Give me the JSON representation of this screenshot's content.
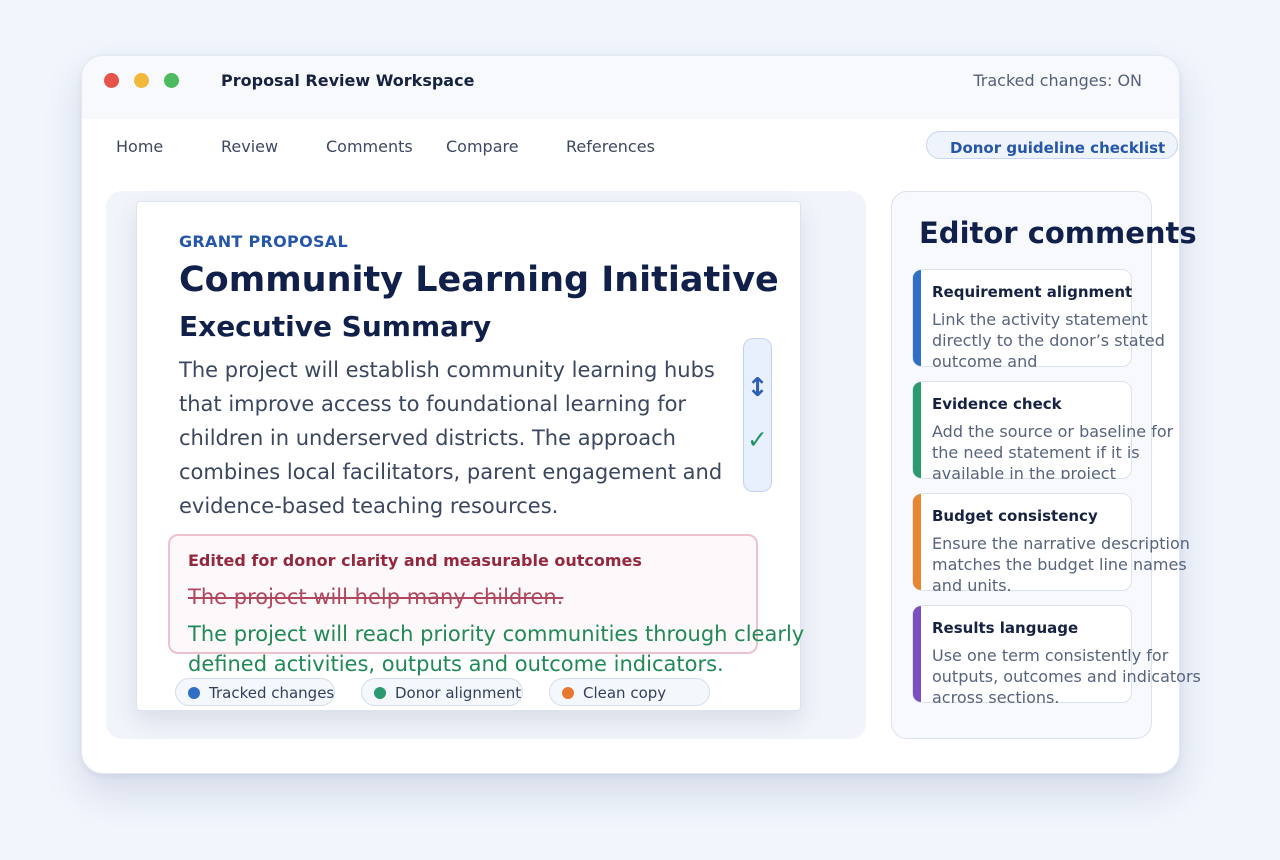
{
  "window": {
    "title": "Proposal Review Workspace",
    "tracked_status": "Tracked changes: ON"
  },
  "menu": {
    "items": [
      "Home",
      "Review",
      "Comments",
      "Compare",
      "References"
    ],
    "checklist_button": "Donor guideline checklist"
  },
  "document": {
    "kicker": "GRANT PROPOSAL",
    "title": "Community Learning Initiative",
    "subtitle": "Executive Summary",
    "body": "The project will establish community learning hubs that improve access to foundational learning for children in underserved districts. The approach combines local facilitators, parent engagement and evidence-based teaching resources.",
    "change": {
      "title": "Edited for donor clarity and measurable outcomes",
      "deleted": "The project will help many children.",
      "inserted": "The project will reach priority communities through clearly defined activities, outputs and outcome indicators."
    },
    "chips": [
      {
        "label": "Tracked changes",
        "color": "#2f6fc6"
      },
      {
        "label": "Donor alignment",
        "color": "#2a9a6f"
      },
      {
        "label": "Clean copy",
        "color": "#e8782f"
      }
    ],
    "tools": {
      "resize_icon": "vertical-resize-icon",
      "accept_icon": "checkmark-icon"
    }
  },
  "comments": {
    "title": "Editor comments",
    "items": [
      {
        "title": "Requirement alignment",
        "text": "Link the activity statement directly to the donor’s stated outcome and",
        "color": "#2f6fc6"
      },
      {
        "title": "Evidence check",
        "text": "Add the source or baseline for the need statement if it is available in the project",
        "color": "#2a9a6f"
      },
      {
        "title": "Budget consistency",
        "text": "Ensure the narrative description matches the budget line names and units.",
        "color": "#e8872f"
      },
      {
        "title": "Results language",
        "text": "Use one term consistently for outputs, outcomes and indicators across sections.",
        "color": "#7b4fc0"
      }
    ]
  },
  "colors": {
    "accent": "#2556a8",
    "heading": "#10204a",
    "deleted": "#b0475d",
    "inserted": "#1f8a56"
  }
}
